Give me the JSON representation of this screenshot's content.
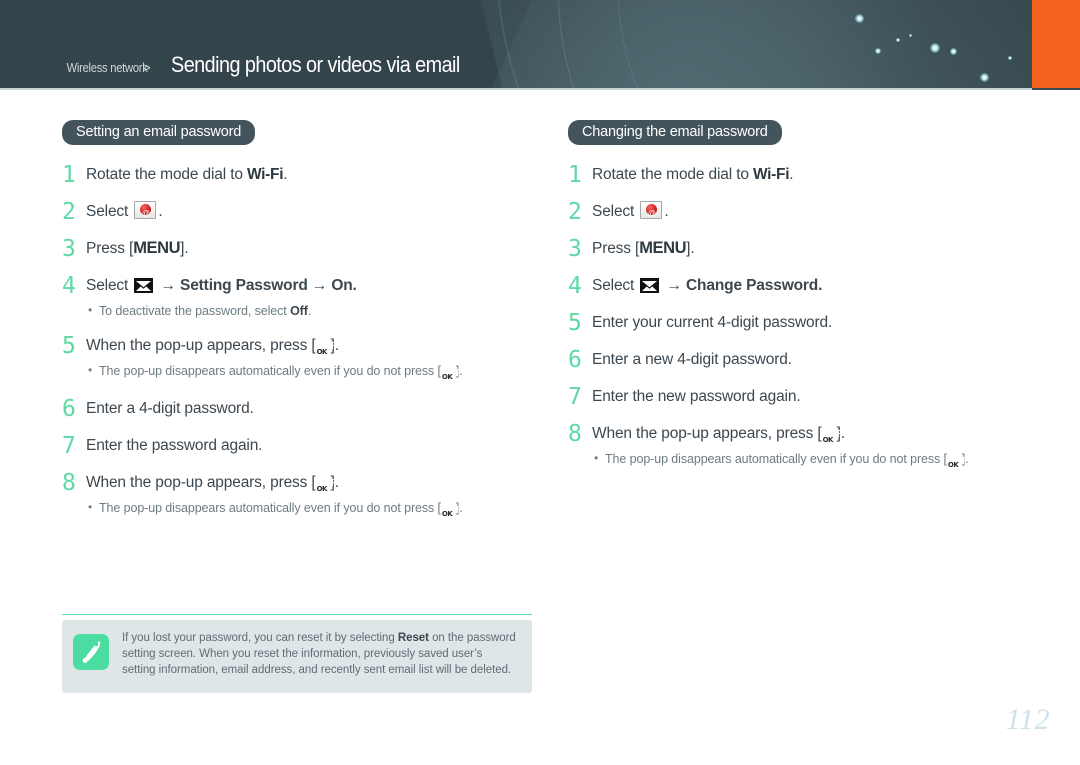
{
  "header": {
    "breadcrumb_parent": "Wireless network",
    "breadcrumb_separator": ">",
    "breadcrumb_current": "Sending photos or videos via email",
    "accent_orange": "#f4641e",
    "background": "#33444a"
  },
  "colors": {
    "step_number_green": "#5dd9a4",
    "pill_background": "#43545c",
    "note_background": "#dfe6e8",
    "note_icon_green": "#4adca0",
    "body_text": "#3c4750",
    "muted_text": "#6d7b83",
    "page_number": "#cfe1ea"
  },
  "left_column": {
    "title": "Setting an email password",
    "steps": [
      {
        "num": "1",
        "pre": "Rotate the mode dial to ",
        "icon": "wifi-label",
        "icon_text": "Wi-Fi",
        "post": ".",
        "bullets": []
      },
      {
        "num": "2",
        "pre": "Select ",
        "icon": "mail-seal-icon",
        "post": ".",
        "bullets": []
      },
      {
        "num": "3",
        "pre": "Press [",
        "icon": "menu-label",
        "icon_text": "MENU",
        "post": "].",
        "bullets": []
      },
      {
        "num": "4",
        "pre": "Select ",
        "icon": "mail-black-icon",
        "post": " → Setting Password → On.",
        "bold_post": true,
        "bullets": [
          {
            "pre": "To deactivate the password, select ",
            "bold": "Off",
            "post": "."
          }
        ]
      },
      {
        "num": "5",
        "pre": "When the pop-up appears, press [",
        "icon": "ok-button-icon",
        "post": "].",
        "bullets": [
          {
            "pre": "The pop-up disappears automatically even if you do not press [",
            "icon": "ok-button-icon",
            "post": "]."
          }
        ]
      },
      {
        "num": "6",
        "pre": "Enter a 4-digit password.",
        "bullets": []
      },
      {
        "num": "7",
        "pre": "Enter the password again.",
        "bullets": []
      },
      {
        "num": "8",
        "pre": "When the pop-up appears, press [",
        "icon": "ok-button-icon",
        "post": "].",
        "bullets": [
          {
            "pre": "The pop-up disappears automatically even if you do not press [",
            "icon": "ok-button-icon",
            "post": "]."
          }
        ]
      }
    ]
  },
  "right_column": {
    "title": "Changing the email password",
    "steps": [
      {
        "num": "1",
        "pre": "Rotate the mode dial to ",
        "icon": "wifi-label",
        "icon_text": "Wi-Fi",
        "post": ".",
        "bullets": []
      },
      {
        "num": "2",
        "pre": "Select ",
        "icon": "mail-seal-icon",
        "post": ".",
        "bullets": []
      },
      {
        "num": "3",
        "pre": "Press [",
        "icon": "menu-label",
        "icon_text": "MENU",
        "post": "].",
        "bullets": []
      },
      {
        "num": "4",
        "pre": "Select ",
        "icon": "mail-black-icon",
        "post": " → Change Password.",
        "bold_post": true,
        "bullets": []
      },
      {
        "num": "5",
        "pre": "Enter your current 4-digit password.",
        "bullets": []
      },
      {
        "num": "6",
        "pre": "Enter a new 4-digit password.",
        "bullets": []
      },
      {
        "num": "7",
        "pre": "Enter the new password again.",
        "bullets": []
      },
      {
        "num": "8",
        "pre": "When the pop-up appears, press [",
        "icon": "ok-button-icon",
        "post": "].",
        "bullets": [
          {
            "pre": "The pop-up disappears automatically even if you do not press [",
            "icon": "ok-button-icon",
            "post": "]."
          }
        ]
      }
    ]
  },
  "note": {
    "icon": "pen-icon",
    "segments": [
      {
        "text": "If you lost your password, you can reset it by selecting "
      },
      {
        "text": "Reset",
        "bold": true
      },
      {
        "text": " on the password setting screen. When you reset the information, previously saved user’s setting information, email address, and recently sent email list will be deleted."
      }
    ]
  },
  "page_number": "112"
}
